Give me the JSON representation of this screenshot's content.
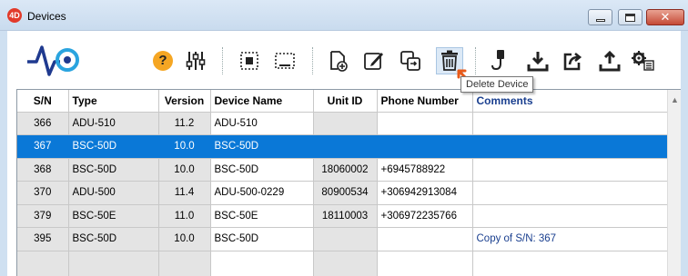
{
  "window": {
    "title": "Devices",
    "app_icon_text": "4D"
  },
  "toolbar": {
    "icons": [
      "help-icon",
      "settings-sliders-icon",
      "select-all-icon",
      "select-none-icon",
      "new-document-icon",
      "edit-icon",
      "duplicate-icon",
      "trash-icon",
      "usb-icon",
      "download-icon",
      "export-icon",
      "upload-icon",
      "gear-list-icon"
    ],
    "help_label": "?",
    "active_tool": "trash-icon"
  },
  "tooltip": {
    "text": "Delete Device"
  },
  "table": {
    "columns": [
      "S/N",
      "Type",
      "Version",
      "Device Name",
      "Unit ID",
      "Phone Number",
      "Comments"
    ],
    "rows": [
      {
        "sn": "366",
        "type": "ADU-510",
        "version": "11.2",
        "device_name": "ADU-510",
        "unit_id": "",
        "phone": "",
        "comments": ""
      },
      {
        "sn": "367",
        "type": "BSC-50D",
        "version": "10.0",
        "device_name": "BSC-50D",
        "unit_id": "",
        "phone": "",
        "comments": ""
      },
      {
        "sn": "368",
        "type": "BSC-50D",
        "version": "10.0",
        "device_name": "BSC-50D",
        "unit_id": "18060002",
        "phone": "+6945788922",
        "comments": ""
      },
      {
        "sn": "370",
        "type": "ADU-500",
        "version": "11.4",
        "device_name": "ADU-500-0229",
        "unit_id": "80900534",
        "phone": "+306942913084",
        "comments": ""
      },
      {
        "sn": "379",
        "type": "BSC-50E",
        "version": "11.0",
        "device_name": "BSC-50E",
        "unit_id": "18110003",
        "phone": "+306972235766",
        "comments": ""
      },
      {
        "sn": "395",
        "type": "BSC-50D",
        "version": "10.0",
        "device_name": "BSC-50D",
        "unit_id": "",
        "phone": "",
        "comments": "Copy of S/N: 367"
      }
    ],
    "selected_row": 1
  },
  "colors": {
    "selection": "#0a78d7",
    "comments_text": "#1a3f8f",
    "accent_help": "#f5a623",
    "trash_active_bg": "#dce9f6"
  }
}
